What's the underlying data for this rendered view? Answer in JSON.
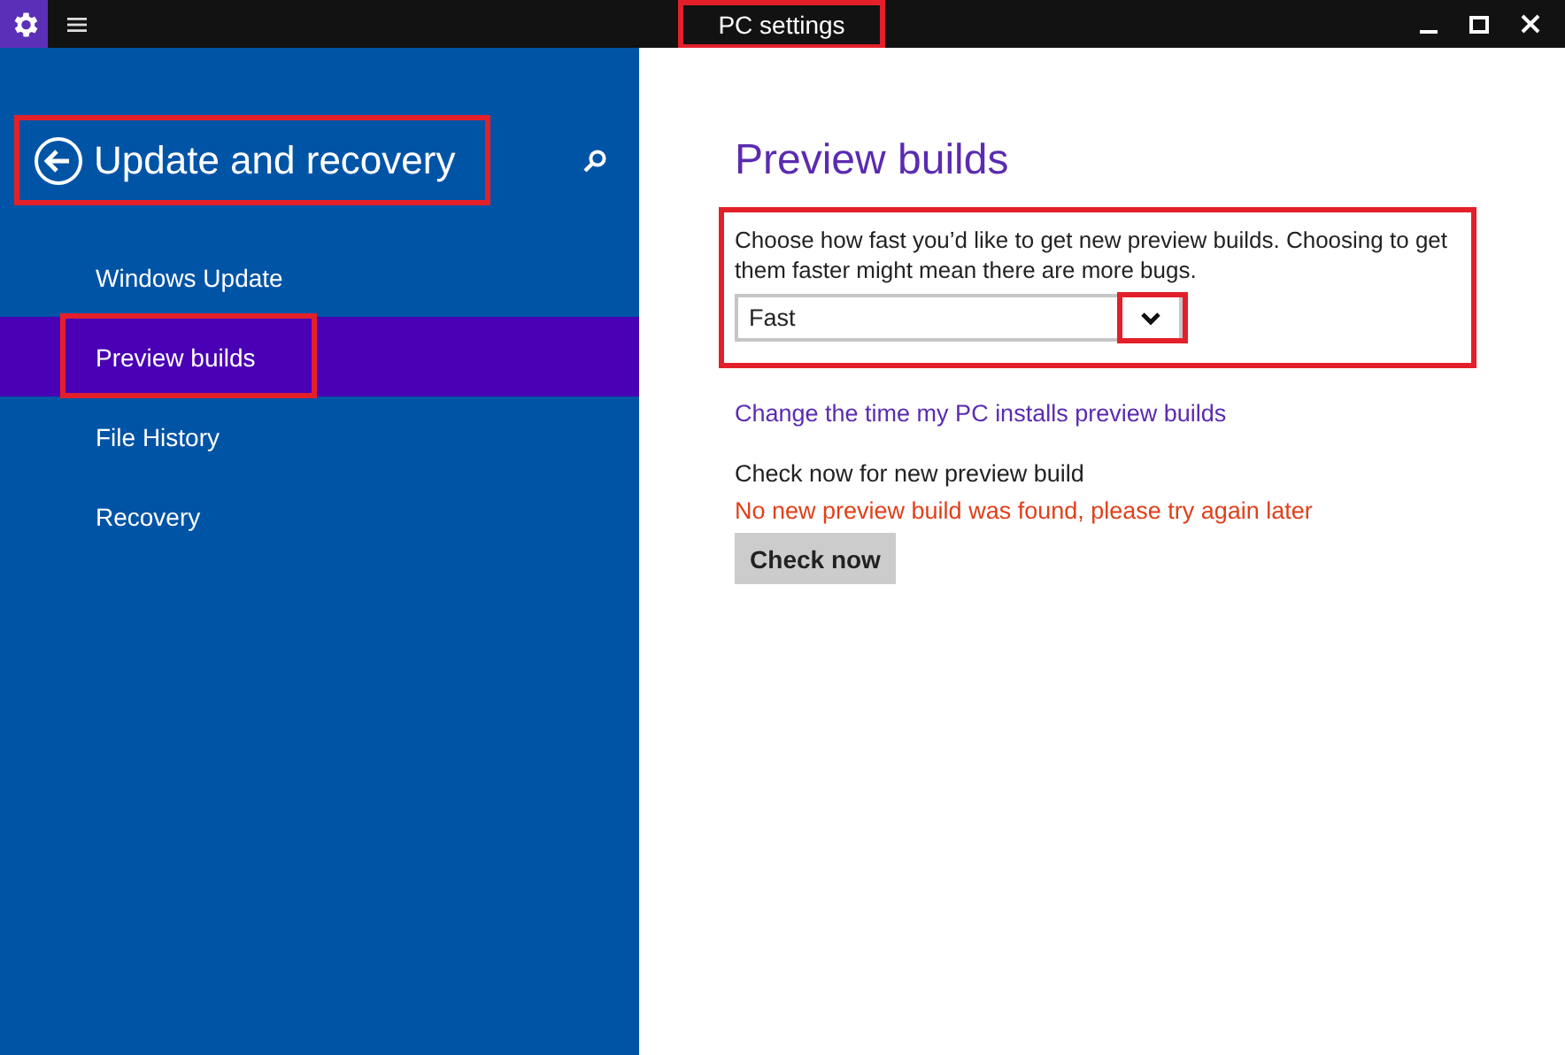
{
  "window": {
    "title": "PC settings"
  },
  "sidebar": {
    "heading": "Update and recovery",
    "items": [
      {
        "label": "Windows Update",
        "selected": false
      },
      {
        "label": "Preview builds",
        "selected": true
      },
      {
        "label": "File History",
        "selected": false
      },
      {
        "label": "Recovery",
        "selected": false
      }
    ]
  },
  "content": {
    "heading": "Preview builds",
    "description": "Choose how fast you’d like to get new preview builds. Choosing to get them faster might mean there are more bugs.",
    "dropdown": {
      "value": "Fast"
    },
    "link": "Change the time my PC installs preview builds",
    "check_label": "Check now for new preview build",
    "status_message": "No new preview build was found, please try again later",
    "button": "Check now"
  }
}
